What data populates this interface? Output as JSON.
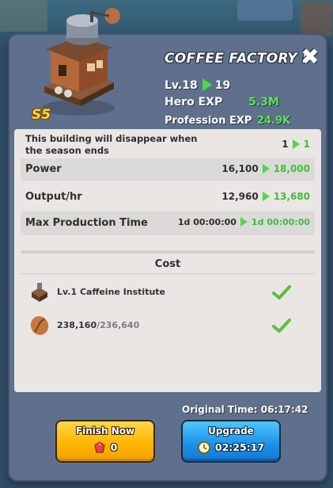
{
  "building": {
    "title": "COFFEE FACTORY I",
    "season": "S5",
    "level_label": "Lv.18",
    "level_next": "19",
    "hero_exp_label": "Hero EXP",
    "hero_exp_value": "5.3M",
    "profession_exp_label": "Profession EXP",
    "profession_exp_value": "24.9K",
    "close_label": "✖"
  },
  "stats": {
    "season_note": "This building will disappear when the season ends",
    "season_from": "1",
    "season_to": "1",
    "power_label": "Power",
    "power_from": "16,100",
    "power_to": "18,000",
    "output_label": "Output/hr",
    "output_from": "12,960",
    "output_to": "13,680",
    "maxprod_label": "Max Production Time",
    "maxprod_from": "1d 00:00:00",
    "maxprod_to": "1d 00:00:00"
  },
  "cost": {
    "header": "Cost",
    "items": [
      {
        "name": "Lv.1 Caffeine Institute",
        "icon": "building-icon",
        "met": true
      },
      {
        "have": "238,160",
        "need": "/236,640",
        "icon": "coffee-bean-icon",
        "met": true
      }
    ]
  },
  "footer": {
    "original_time": "Original Time: 06:17:42",
    "finish_now_label": "Finish Now",
    "finish_now_cost": "0",
    "upgrade_label": "Upgrade",
    "upgrade_time": "02:25:17"
  },
  "colors": {
    "accent_green": "#3fbf3a",
    "finish_btn": "#ffb600",
    "upgrade_btn": "#1e8fe6",
    "panel": "#5f708c"
  }
}
